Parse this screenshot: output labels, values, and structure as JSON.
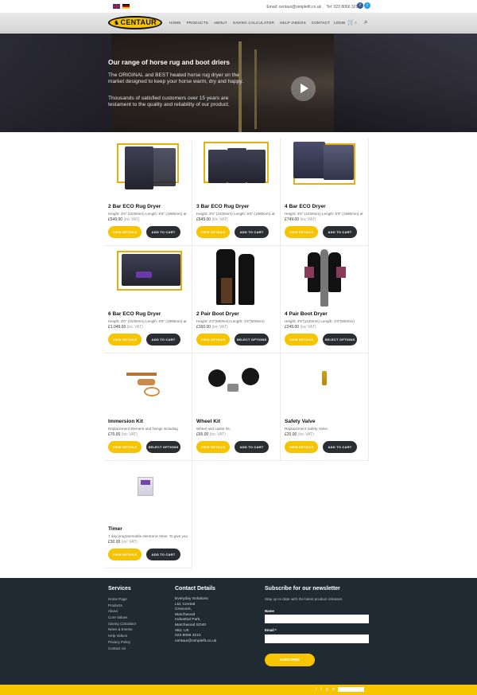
{
  "topbar": {
    "email": "Email: centaur@simplefit.co.uk",
    "phone": "Tel: 023 8066 3210",
    "social": [
      "facebook-icon",
      "twitter-icon"
    ]
  },
  "nav": {
    "logo_text": "CENTAUR",
    "links": [
      "HOME",
      "PRODUCTS",
      "ABOUT",
      "SAVING CALCULATOR",
      "HELP VIDEOS",
      "CONTACT"
    ],
    "login": "LOGIN",
    "cart_count": "0"
  },
  "hero": {
    "title": "Our range of horse rug and boot driers",
    "p1": "The ORIGINAL and BEST heated horse rug dryer on the market designed to keep your horse warm, dry and happy.",
    "p2": "Thousands of satisfied customers over 15 years are testament to the quality and reliability of our product."
  },
  "products": [
    {
      "name": "2 Bar ECO Rug Dryer",
      "desc": "Height: 3'6\" (1030mm) Length: 6'6\" (1980mm) at",
      "price": "£549.00",
      "vat": "(inc VAT)",
      "view": "VIEW DETAILS",
      "action": "ADD TO CART"
    },
    {
      "name": "3 Bar ECO Rug Dryer",
      "desc": "Height: 3'6\" (1030mm) Length: 6'6\" (1980mm) at",
      "price": "£649.00",
      "vat": "(inc VAT)",
      "view": "VIEW DETAILS",
      "action": "ADD TO CART"
    },
    {
      "name": "4 Bar ECO Dryer",
      "desc": "Height: 3'6\" (1030mm) Length: 6'6\" (1980mm) at",
      "price": "£749.00",
      "vat": "(inc VAT)",
      "view": "VIEW DETAILS",
      "action": "ADD TO CART"
    },
    {
      "name": "6 Bar ECO Rug Dryer",
      "desc": "Height: 3'6\" (1030mm) Length: 6'6\" (1980mm) at",
      "price": "£1,049.00",
      "vat": "(inc VAT)",
      "view": "VIEW DETAILS",
      "action": "ADD TO CART"
    },
    {
      "name": "2 Pair Boot Dryer",
      "desc": "Height: 2'3\"(680mm) Length: 1'8\"(500mm)",
      "price": "£160.00",
      "vat": "(inc VAT)",
      "view": "VIEW DETAILS",
      "action": "SELECT OPTIONS"
    },
    {
      "name": "4 Pair Boot Dryer",
      "desc": "Height: 3'9\"(1120mm) Length: 1'8\"(500mm)",
      "price": "£245.00",
      "vat": "(inc VAT)",
      "view": "VIEW DETAILS",
      "action": "SELECT OPTIONS"
    },
    {
      "name": "Immersion Kit",
      "desc": "Replacement Element and fixings including",
      "price": "£70.00",
      "vat": "(inc VAT)",
      "view": "VIEW DETAILS",
      "action": "SELECT OPTIONS"
    },
    {
      "name": "Wheel Kit",
      "desc": "Wheel and castor kit.",
      "price": "£65.00",
      "vat": "(inc VAT)",
      "view": "VIEW DETAILS",
      "action": "ADD TO CART"
    },
    {
      "name": "Safety Valve",
      "desc": "Replacement Safety Valve.",
      "price": "£20.00",
      "vat": "(inc VAT)",
      "view": "VIEW DETAILS",
      "action": "ADD TO CART"
    },
    {
      "name": "Timer",
      "desc": "7 day programmable electronic timer. To give you",
      "price": "£30.00",
      "vat": "(inc VAT)",
      "view": "VIEW DETAILS",
      "action": "ADD TO CART"
    }
  ],
  "footer": {
    "services_title": "Services",
    "services": [
      "Home Page",
      "Products",
      "About",
      "Core Values",
      "Saving Calculator",
      "News & Events",
      "Help Videos",
      "Privacy Policy",
      "Contact Us"
    ],
    "contact_title": "Contact Details",
    "address": [
      "Everyday Solutions",
      "Ltd, Central",
      "Crescent,",
      "Marchwood",
      "Industrial Park,",
      "Marchwood SO40",
      "4BJ, UK",
      "023 8066 3210",
      "centaur@simplefit.co.uk"
    ],
    "newsletter_title": "Subscribe for our newsletter",
    "newsletter_sub": "Stay up to date with the latest product releases",
    "name_label": "Name",
    "email_label": "Email *",
    "subscribe": "SUBSCRIBE"
  },
  "colors": {
    "accent": "#f6c400",
    "dark": "#1f2a33",
    "button_dark": "#2a2e33"
  }
}
